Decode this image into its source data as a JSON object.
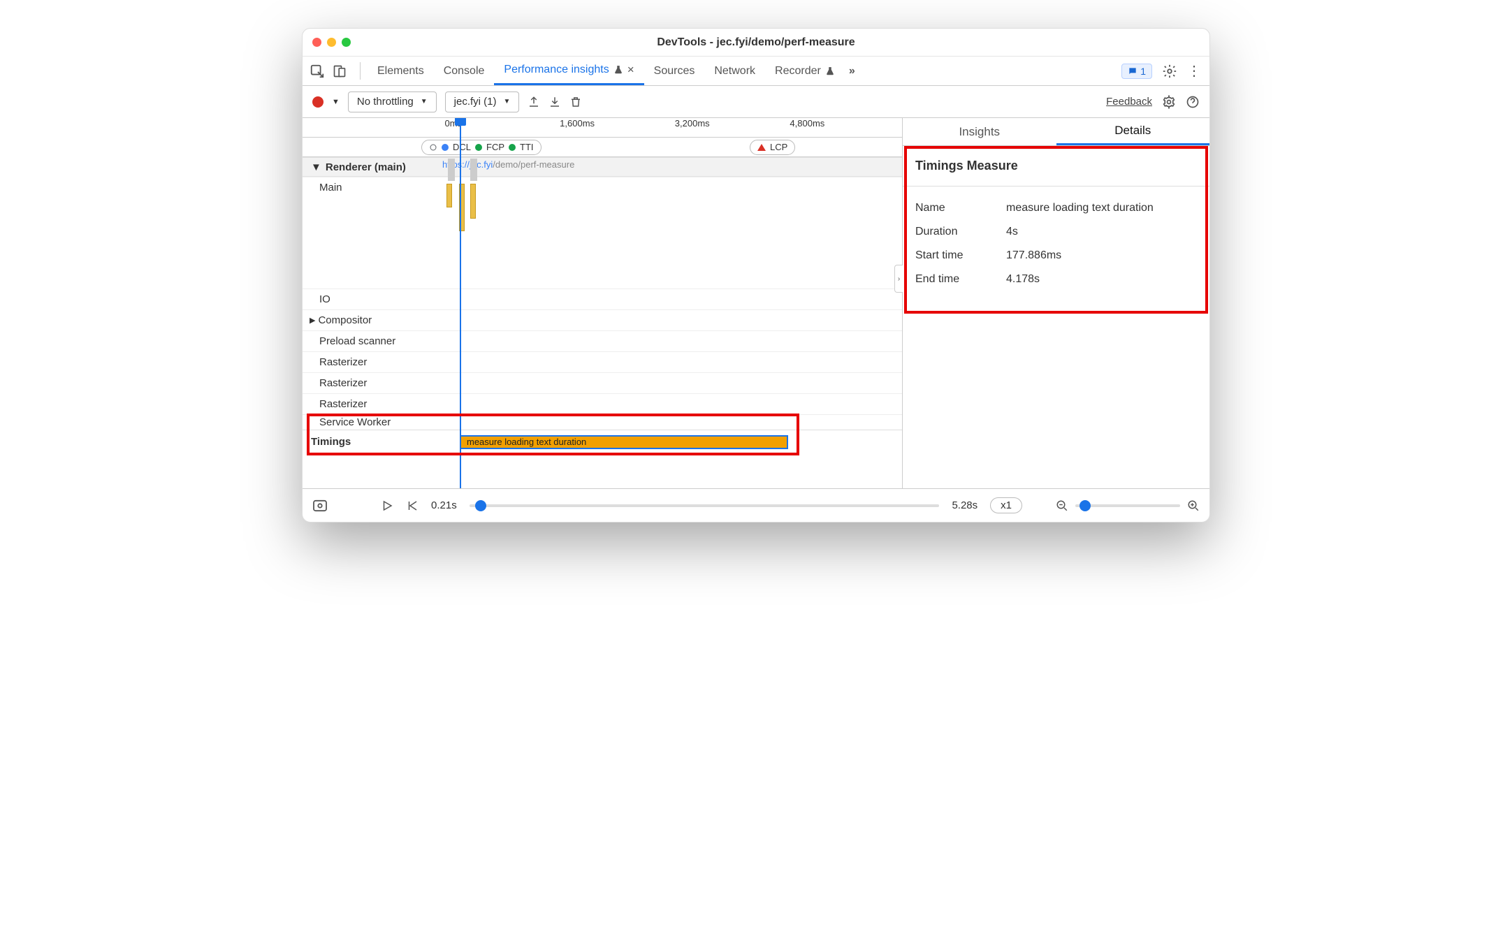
{
  "window": {
    "title": "DevTools - jec.fyi/demo/perf-measure"
  },
  "tabs": {
    "elements": "Elements",
    "console": "Console",
    "perf": "Performance insights",
    "sources": "Sources",
    "network": "Network",
    "recorder": "Recorder",
    "issues_count": "1"
  },
  "toolbar": {
    "throttle": "No throttling",
    "recording": "jec.fyi (1)",
    "feedback": "Feedback"
  },
  "timeline": {
    "ticks": [
      "0ms",
      "1,600ms",
      "3,200ms",
      "4,800ms"
    ],
    "markers": {
      "dcl": "DCL",
      "fcp": "FCP",
      "tti": "TTI",
      "lcp": "LCP"
    },
    "url_prefix": "https://jec.fyi",
    "url_suffix": "/demo/perf-measure",
    "tracks": {
      "renderer": "Renderer (main)",
      "main": "Main",
      "io": "IO",
      "compositor": "Compositor",
      "preload": "Preload scanner",
      "rasterizer": "Rasterizer",
      "service_worker": "Service Worker",
      "timings": "Timings"
    },
    "timings_bar": "measure loading text duration"
  },
  "right": {
    "tabs": {
      "insights": "Insights",
      "details": "Details"
    },
    "details": {
      "title": "Timings Measure",
      "rows": {
        "name_k": "Name",
        "name_v": "measure loading text duration",
        "duration_k": "Duration",
        "duration_v": "4s",
        "start_k": "Start time",
        "start_v": "177.886ms",
        "end_k": "End time",
        "end_v": "4.178s"
      }
    }
  },
  "footer": {
    "start": "0.21s",
    "end": "5.28s",
    "zoom": "x1"
  }
}
